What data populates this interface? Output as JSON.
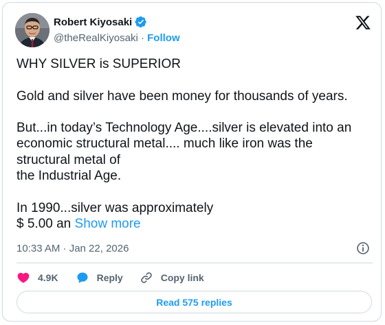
{
  "author": {
    "display_name": "Robert Kiyosaki",
    "handle": "@theRealKiyosaki",
    "separator": "·",
    "follow_label": "Follow",
    "verified_icon": "verified-badge-icon",
    "platform_icon": "x-logo-icon"
  },
  "tweet": {
    "paragraphs": [
      [
        "WHY SILVER is SUPERIOR"
      ],
      [
        "Gold and silver have been money for thousands of years."
      ],
      [
        "But...in today’s Technology Age....silver is elevated into an",
        "economic structural metal.... much like iron was the",
        "structural metal of",
        "the Industrial Age."
      ]
    ],
    "last_paragraph": {
      "line1": "In 1990...silver was approximately",
      "line2_text": "$ 5.00 an ",
      "show_more_label": "Show more"
    },
    "timestamp": "10:33 AM · Jan 22, 2026",
    "info_icon": "info-icon"
  },
  "actions": {
    "like_count": "4.9K",
    "reply_label": "Reply",
    "copy_link_label": "Copy link",
    "like_icon": "heart-icon",
    "reply_icon": "speech-bubble-icon",
    "copy_icon": "link-icon"
  },
  "read_replies_label": "Read 575 replies",
  "colors": {
    "text": "#0f1419",
    "secondary": "#536471",
    "accent": "#1d9bf0",
    "like": "#f91880",
    "border": "#cfd9de"
  }
}
